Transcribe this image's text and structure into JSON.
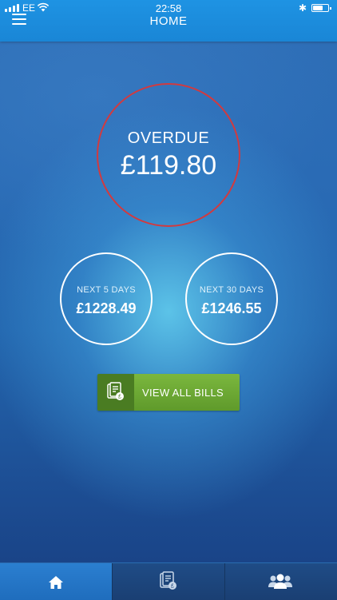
{
  "status_bar": {
    "carrier": "EE",
    "time": "22:58"
  },
  "header": {
    "title": "HOME"
  },
  "summary": {
    "overdue_label": "OVERDUE",
    "overdue_amount": "£119.80",
    "next5_label": "NEXT 5 DAYS",
    "next5_amount": "£1228.49",
    "next30_label": "NEXT 30 DAYS",
    "next30_amount": "£1246.55"
  },
  "actions": {
    "view_all_label": "VIEW ALL BILLS",
    "view_all_icon": "bills-icon"
  },
  "tabs": [
    {
      "icon": "home-icon",
      "active": true
    },
    {
      "icon": "bills-icon",
      "active": false
    },
    {
      "icon": "group-icon",
      "active": false
    }
  ],
  "colors": {
    "header": "#1a86d6",
    "overdue_ring": "#d23a3f",
    "button_green": "#6faa35",
    "button_icon_bg": "#4a7c22",
    "tabbar": "#1a3f73",
    "tab_active": "#2276c6"
  }
}
